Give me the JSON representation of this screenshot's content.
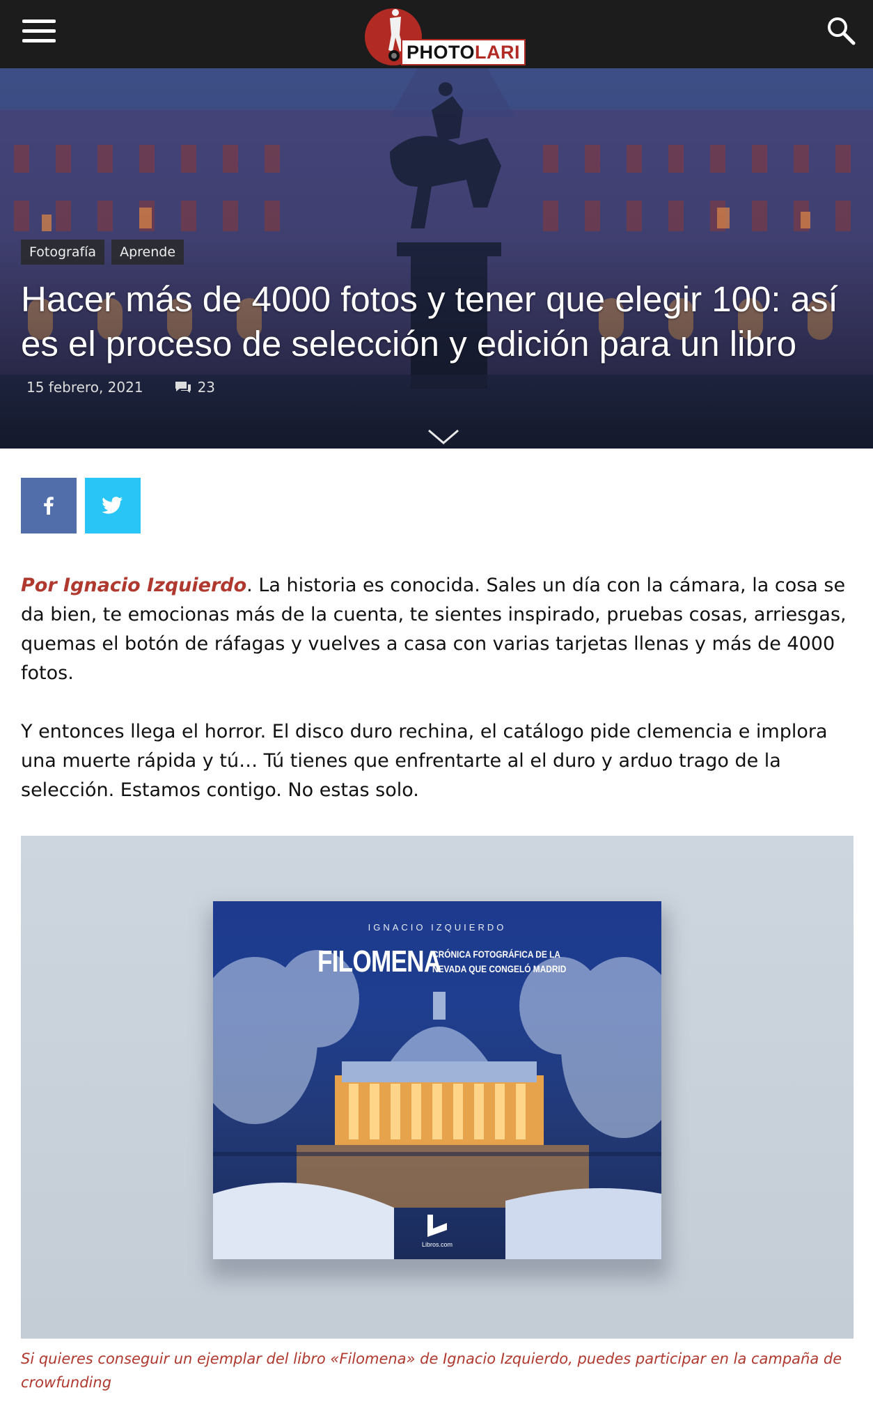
{
  "header": {
    "logo_text_main": "PHOTO",
    "logo_text_accent": "LARI",
    "menu_icon": "hamburger-menu-icon",
    "search_icon": "search-icon"
  },
  "hero": {
    "categories": [
      "Fotografía",
      "Aprende"
    ],
    "title": "Hacer más de 4000 fotos y tener que elegir 100: así es el proceso de selección y edición para un libro",
    "date": "15 febrero, 2021",
    "comment_count": "23",
    "scroll_icon": "chevron-down-icon"
  },
  "share": {
    "facebook_icon": "facebook-icon",
    "twitter_icon": "twitter-icon",
    "facebook_color": "#516eab",
    "twitter_color": "#29c5f6"
  },
  "article": {
    "author": "Por Ignacio Izquierdo",
    "p1_rest": ". La historia es conocida. Sales un día con la cámara, la cosa se da bien, te emocionas más de la cuenta, te sientes inspirado, pruebas cosas, arriesgas, quemas el botón de ráfagas y vuelves a casa con varias tarjetas llenas y más de 4000 fotos.",
    "p2": "Y entonces llega el horror. El disco duro rechina, el catálogo pide clemencia e implora una muerte rápida y tú… Tú tienes que enfrentarte al el duro y arduo trago de la selección. Estamos contigo. No estas solo."
  },
  "figure": {
    "book_author": "IGNACIO IZQUIERDO",
    "book_title": "FILOMENA",
    "book_subtitle_1": "CRÓNICA FOTOGRÁFICA DE LA",
    "book_subtitle_2": "NEVADA QUE CONGELÓ MADRID",
    "publisher": "Libros.com",
    "caption": "Si quieres conseguir un ejemplar del libro «Filomena» de Ignacio Izquierdo, puedes participar en la campaña de crowfunding"
  },
  "colors": {
    "accent": "#b0392f",
    "header_bg": "#1c1c1c"
  }
}
